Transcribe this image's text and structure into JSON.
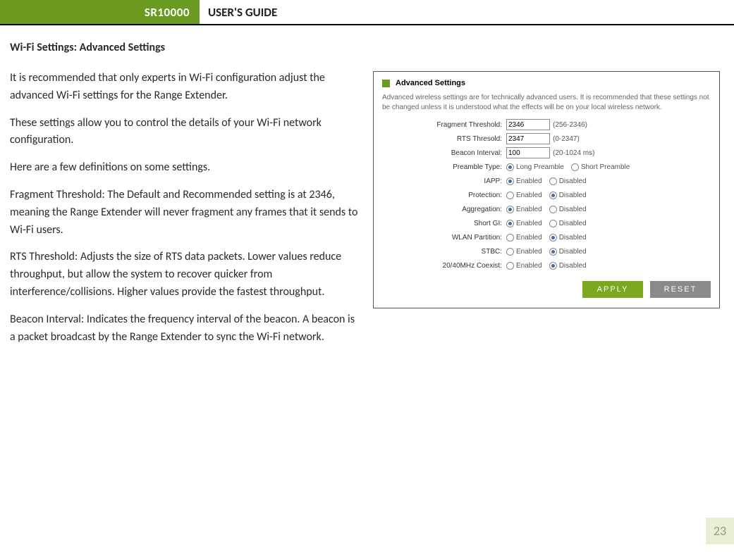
{
  "header": {
    "model": "SR10000",
    "guide": "USER'S GUIDE"
  },
  "section_title": "Wi-Fi Settings: Advanced Settings",
  "paragraphs": {
    "p1": "It is recommended that only experts in Wi-Fi configuration adjust the advanced Wi-Fi settings for the Range Extender.",
    "p2": "These settings allow you to control the details of your Wi-Fi network configuration.",
    "p3": "Here are a few definitions on some settings.",
    "p4": "Fragment Threshold: The Default and Recommended setting is at 2346, meaning the Range Extender will never fragment any frames that it sends to Wi-Fi users.",
    "p5": "RTS Threshold: Adjusts the size of RTS data packets. Lower values reduce throughput, but allow the system to recover quicker from interference/collisions. Higher values provide the fastest throughput.",
    "p6": "Beacon Interval: Indicates the frequency interval of the beacon. A beacon is a packet broadcast by the Range Extender to sync the Wi-Fi network."
  },
  "panel": {
    "title": "Advanced Settings",
    "desc": "Advanced wireless settings are for technically advanced users. It is recommended that these settings not be changed unless it is understood what the effects will be on your local wireless network.",
    "fragment": {
      "label": "Fragment Threshold:",
      "value": "2346",
      "hint": "(256-2346)"
    },
    "rts": {
      "label": "RTS Thresold:",
      "value": "2347",
      "hint": "(0-2347)"
    },
    "beacon": {
      "label": "Beacon Interval:",
      "value": "100",
      "hint": "(20-1024 ms)"
    },
    "preamble": {
      "label": "Preamble Type:",
      "opt1": "Long Preamble",
      "opt2": "Short Preamble"
    },
    "iapp": {
      "label": "IAPP:",
      "opt1": "Enabled",
      "opt2": "Disabled"
    },
    "protection": {
      "label": "Protection:",
      "opt1": "Enabled",
      "opt2": "Disabled"
    },
    "aggregation": {
      "label": "Aggregation:",
      "opt1": "Enabled",
      "opt2": "Disabled"
    },
    "shortgi": {
      "label": "Short GI:",
      "opt1": "Enabled",
      "opt2": "Disabled"
    },
    "wlan": {
      "label": "WLAN Partition:",
      "opt1": "Enabled",
      "opt2": "Disabled"
    },
    "stbc": {
      "label": "STBC:",
      "opt1": "Enabled",
      "opt2": "Disabled"
    },
    "coexist": {
      "label": "20/40MHz Coexist:",
      "opt1": "Enabled",
      "opt2": "Disabled"
    },
    "apply": "APPLY",
    "reset": "RESET"
  },
  "page_number": "23"
}
